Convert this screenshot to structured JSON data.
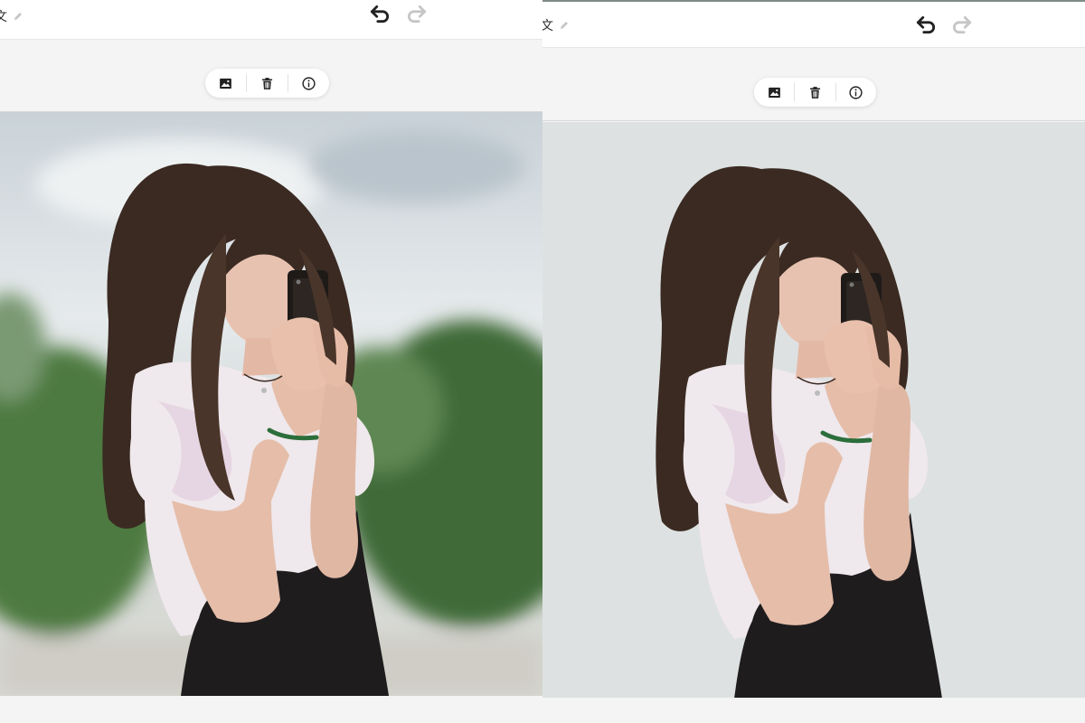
{
  "panels": [
    {
      "side": "original",
      "document_title": "文",
      "icons": {
        "edit": "pencil-icon",
        "undo": "undo-icon",
        "redo": "redo-icon",
        "image": "image-icon",
        "delete": "trash-icon",
        "info": "info-icon"
      },
      "photo_background": "outdoor-sky-and-trees"
    },
    {
      "side": "background-removed",
      "document_title": "文",
      "icons": {
        "edit": "pencil-icon",
        "undo": "undo-icon",
        "redo": "redo-icon",
        "image": "image-icon",
        "delete": "trash-icon",
        "info": "info-icon"
      },
      "photo_background": "#dde1e1"
    }
  ],
  "colors": {
    "app_background": "#f4f4f5",
    "topbar": "#ffffff",
    "icon_active": "#222222",
    "icon_disabled": "#c6c6c6",
    "removed_bg": "#dde1e1"
  }
}
